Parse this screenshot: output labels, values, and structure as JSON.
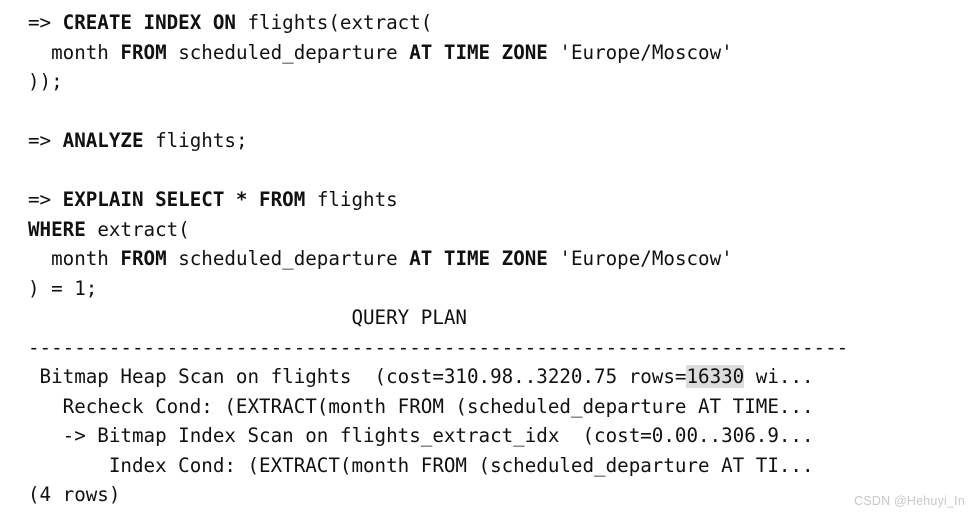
{
  "terminal": {
    "lines": [
      {
        "id": "create-index-line-1",
        "segments": [
          {
            "text": "=> ",
            "style": "plain"
          },
          {
            "text": "CREATE INDEX ON ",
            "style": "kw"
          },
          {
            "text": "flights(extract(",
            "style": "plain"
          }
        ]
      },
      {
        "id": "create-index-line-2",
        "segments": [
          {
            "text": "  month ",
            "style": "plain"
          },
          {
            "text": "FROM ",
            "style": "kw"
          },
          {
            "text": "scheduled_departure ",
            "style": "plain"
          },
          {
            "text": "AT TIME ZONE ",
            "style": "kw"
          },
          {
            "text": "'Europe/Moscow'",
            "style": "plain"
          }
        ]
      },
      {
        "id": "create-index-line-3",
        "segments": [
          {
            "text": "));",
            "style": "plain"
          }
        ]
      },
      {
        "id": "blank-1",
        "segments": []
      },
      {
        "id": "analyze-line",
        "segments": [
          {
            "text": "=> ",
            "style": "plain"
          },
          {
            "text": "ANALYZE ",
            "style": "kw"
          },
          {
            "text": "flights;",
            "style": "plain"
          }
        ]
      },
      {
        "id": "blank-2",
        "segments": []
      },
      {
        "id": "explain-line-1",
        "segments": [
          {
            "text": "=> ",
            "style": "plain"
          },
          {
            "text": "EXPLAIN SELECT * FROM ",
            "style": "kw"
          },
          {
            "text": "flights",
            "style": "plain"
          }
        ]
      },
      {
        "id": "explain-line-2",
        "segments": [
          {
            "text": "WHERE ",
            "style": "kw"
          },
          {
            "text": "extract(",
            "style": "plain"
          }
        ]
      },
      {
        "id": "explain-line-3",
        "segments": [
          {
            "text": "  month ",
            "style": "plain"
          },
          {
            "text": "FROM ",
            "style": "kw"
          },
          {
            "text": "scheduled_departure ",
            "style": "plain"
          },
          {
            "text": "AT TIME ZONE ",
            "style": "kw"
          },
          {
            "text": "'Europe/Moscow'",
            "style": "plain"
          }
        ]
      },
      {
        "id": "explain-line-4",
        "segments": [
          {
            "text": ") = 1;",
            "style": "plain"
          }
        ]
      },
      {
        "id": "query-plan-header",
        "segments": [
          {
            "text": "                            QUERY PLAN",
            "style": "plain"
          }
        ]
      },
      {
        "id": "query-plan-separator",
        "segments": [
          {
            "text": "-----------------------------------------------------------------------",
            "style": "plain"
          }
        ]
      },
      {
        "id": "plan-row-1",
        "segments": [
          {
            "text": " Bitmap Heap Scan on flights  (cost=310.98..3220.75 rows=",
            "style": "plain"
          },
          {
            "text": "16330",
            "style": "hl"
          },
          {
            "text": " wi...",
            "style": "plain"
          }
        ]
      },
      {
        "id": "plan-row-2",
        "segments": [
          {
            "text": "   Recheck Cond: (EXTRACT(month FROM (scheduled_departure AT TIME...",
            "style": "plain"
          }
        ]
      },
      {
        "id": "plan-row-3",
        "segments": [
          {
            "text": "   -> Bitmap Index Scan on flights_extract_idx  (cost=0.00..306.9...",
            "style": "plain"
          }
        ]
      },
      {
        "id": "plan-row-4",
        "segments": [
          {
            "text": "       Index Cond: (EXTRACT(month FROM (scheduled_departure AT TI...",
            "style": "plain"
          }
        ]
      },
      {
        "id": "row-count-line",
        "segments": [
          {
            "text": "(4 rows)",
            "style": "plain"
          }
        ]
      }
    ]
  },
  "watermark": {
    "text": "CSDN @Hehuyi_In"
  },
  "colors": {
    "background": "#ffffff",
    "text": "#111111",
    "highlight": "#dcdcdc",
    "watermark": "#c8c8c8"
  }
}
